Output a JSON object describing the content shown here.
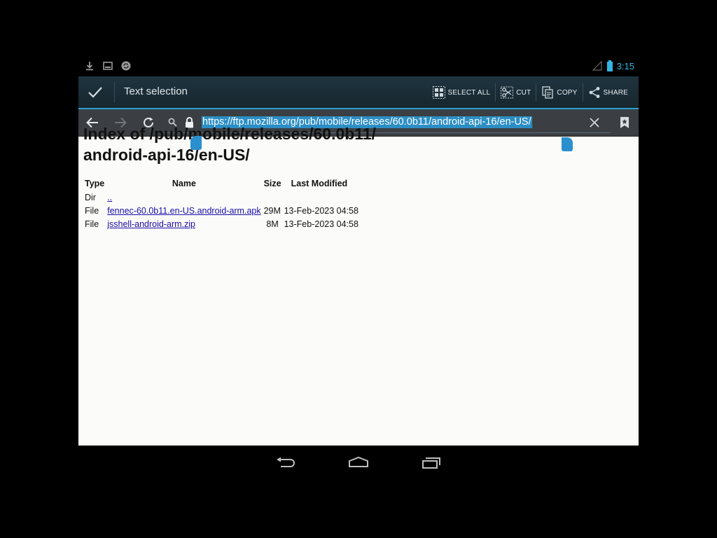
{
  "status_bar": {
    "time": "3:15",
    "left_icons": [
      "download-icon",
      "screenshot-icon",
      "sync-icon"
    ],
    "right_icons": [
      "signal-icon",
      "battery-icon"
    ],
    "accent": "#33b5e5"
  },
  "action_bar": {
    "title": "Text selection",
    "actions": {
      "select_all": "SELECT ALL",
      "cut": "CUT",
      "copy": "COPY",
      "share": "SHARE"
    }
  },
  "toolbar": {
    "url": "https://ftp.mozilla.org/pub/mobile/releases/60.0b11/android-api-16/en-US/",
    "selection_color": "#2c8ec4"
  },
  "page": {
    "heading_line1": "Index of /pub/mobile/releases/60.0b11/",
    "heading_line2": "android-api-16/en-US/",
    "columns": {
      "type": "Type",
      "name": "Name",
      "size": "Size",
      "modified": "Last Modified"
    },
    "rows": [
      {
        "type": "Dir",
        "name": "..",
        "size": "",
        "modified": ""
      },
      {
        "type": "File",
        "name": "fennec-60.0b11.en-US.android-arm.apk",
        "size": "29M",
        "modified": "13-Feb-2023 04:58"
      },
      {
        "type": "File",
        "name": "jsshell-android-arm.zip",
        "size": "8M",
        "modified": "13-Feb-2023 04:58"
      }
    ]
  },
  "nav_bar": {
    "buttons": [
      "back-icon",
      "home-icon",
      "recent-apps-icon"
    ]
  }
}
